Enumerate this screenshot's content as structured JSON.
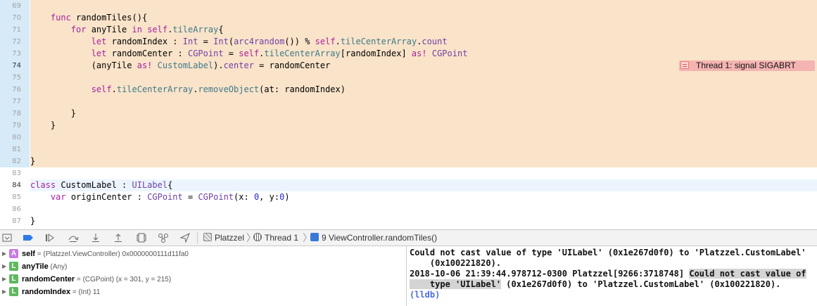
{
  "editor": {
    "lines": [
      {
        "num": "69",
        "hl": true,
        "parts": [
          {
            "t": ""
          }
        ]
      },
      {
        "num": "70",
        "hl": true,
        "parts": [
          {
            "t": "    "
          },
          {
            "t": "func",
            "c": "kw"
          },
          {
            "t": " randomTiles(){"
          }
        ]
      },
      {
        "num": "71",
        "hl": true,
        "parts": [
          {
            "t": "        "
          },
          {
            "t": "for",
            "c": "kw"
          },
          {
            "t": " anyTile "
          },
          {
            "t": "in",
            "c": "kw"
          },
          {
            "t": " "
          },
          {
            "t": "self",
            "c": "kw"
          },
          {
            "t": "."
          },
          {
            "t": "tileArray",
            "c": "fn"
          },
          {
            "t": "{"
          }
        ]
      },
      {
        "num": "72",
        "hl": true,
        "parts": [
          {
            "t": "            "
          },
          {
            "t": "let",
            "c": "kw"
          },
          {
            "t": " randomIndex : "
          },
          {
            "t": "Int",
            "c": "ty"
          },
          {
            "t": " = "
          },
          {
            "t": "Int",
            "c": "ty"
          },
          {
            "t": "("
          },
          {
            "t": "arc4random",
            "c": "ty"
          },
          {
            "t": "()) % "
          },
          {
            "t": "self",
            "c": "kw"
          },
          {
            "t": "."
          },
          {
            "t": "tileCenterArray",
            "c": "fn"
          },
          {
            "t": "."
          },
          {
            "t": "count",
            "c": "ty"
          }
        ]
      },
      {
        "num": "73",
        "hl": true,
        "parts": [
          {
            "t": "            "
          },
          {
            "t": "let",
            "c": "kw"
          },
          {
            "t": " randomCenter : "
          },
          {
            "t": "CGPoint",
            "c": "ty"
          },
          {
            "t": " = "
          },
          {
            "t": "self",
            "c": "kw"
          },
          {
            "t": "."
          },
          {
            "t": "tileCenterArray",
            "c": "fn"
          },
          {
            "t": "[randomIndex] "
          },
          {
            "t": "as!",
            "c": "kw"
          },
          {
            "t": " "
          },
          {
            "t": "CGPoint",
            "c": "ty"
          }
        ]
      },
      {
        "num": "74",
        "hl": true,
        "current": true,
        "parts": [
          {
            "t": "            (anyTile "
          },
          {
            "t": "as!",
            "c": "kw"
          },
          {
            "t": " "
          },
          {
            "t": "CustomLabel",
            "c": "fn"
          },
          {
            "t": ")."
          },
          {
            "t": "center",
            "c": "ty"
          },
          {
            "t": " = randomCenter"
          }
        ]
      },
      {
        "num": "75",
        "hl": true,
        "parts": [
          {
            "t": ""
          }
        ]
      },
      {
        "num": "76",
        "hl": true,
        "parts": [
          {
            "t": "            "
          },
          {
            "t": "self",
            "c": "kw"
          },
          {
            "t": "."
          },
          {
            "t": "tileCenterArray",
            "c": "fn"
          },
          {
            "t": "."
          },
          {
            "t": "removeObject",
            "c": "fn"
          },
          {
            "t": "(at: randomIndex)"
          }
        ]
      },
      {
        "num": "77",
        "hl": true,
        "parts": [
          {
            "t": ""
          }
        ]
      },
      {
        "num": "78",
        "hl": true,
        "parts": [
          {
            "t": "        }"
          }
        ]
      },
      {
        "num": "79",
        "hl": true,
        "parts": [
          {
            "t": "    }"
          }
        ]
      },
      {
        "num": "80",
        "hl": true,
        "parts": [
          {
            "t": ""
          }
        ]
      },
      {
        "num": "81",
        "hl": true,
        "parts": [
          {
            "t": ""
          }
        ]
      },
      {
        "num": "82",
        "hl": true,
        "parts": [
          {
            "t": "}"
          }
        ]
      },
      {
        "num": "83",
        "parts": [
          {
            "t": ""
          }
        ]
      },
      {
        "num": "84",
        "cursor": true,
        "parts": [
          {
            "t": "class",
            "c": "kw"
          },
          {
            "t": " CustomLabel : "
          },
          {
            "t": "UILabel",
            "c": "ty"
          },
          {
            "t": "{"
          }
        ]
      },
      {
        "num": "85",
        "parts": [
          {
            "t": "    "
          },
          {
            "t": "var",
            "c": "kw"
          },
          {
            "t": " originCenter : "
          },
          {
            "t": "CGPoint",
            "c": "ty"
          },
          {
            "t": " = "
          },
          {
            "t": "CGPoint",
            "c": "ty"
          },
          {
            "t": "(x: "
          },
          {
            "t": "0",
            "c": "num"
          },
          {
            "t": ", y:"
          },
          {
            "t": "0",
            "c": "num"
          },
          {
            "t": ")"
          }
        ]
      },
      {
        "num": "86",
        "parts": [
          {
            "t": ""
          }
        ]
      },
      {
        "num": "87",
        "parts": [
          {
            "t": "}"
          }
        ]
      }
    ],
    "error_message": "Thread 1: signal SIGABRT"
  },
  "debug_bar": {
    "scheme": "Platzzel",
    "thread": "Thread 1",
    "frame": "9 ViewController.randomTiles()"
  },
  "variables": [
    {
      "badge": "A",
      "badge_color": "#c77be0",
      "name": "self",
      "value": " = (Platzzel.ViewController) 0x0000000111d11fa0"
    },
    {
      "badge": "L",
      "badge_color": "#5fb85f",
      "name": "anyTile",
      "value": " (Any)"
    },
    {
      "badge": "L",
      "badge_color": "#5fb85f",
      "name": "randomCenter",
      "value": " = (CGPoint) (x = 301, y = 215)"
    },
    {
      "badge": "L",
      "badge_color": "#5fb85f",
      "name": "randomIndex",
      "value": " = (Int) 11"
    }
  ],
  "console": {
    "line1": "Could not cast value of type 'UILabel' (0x1e267d0f0) to 'Platzzel.CustomLabel'",
    "line2": "    (0x100221820).",
    "line3_prefix": "2018-10-06 21:39:44.978712-0300 Platzzel[9266:3718748] ",
    "line3_selected": "Could not cast value of",
    "line4_selected": "    type 'UILabel'",
    "line4_rest": " (0x1e267d0f0) to 'Platzzel.CustomLabel' (0x100221820).",
    "prompt": "(lldb)"
  }
}
